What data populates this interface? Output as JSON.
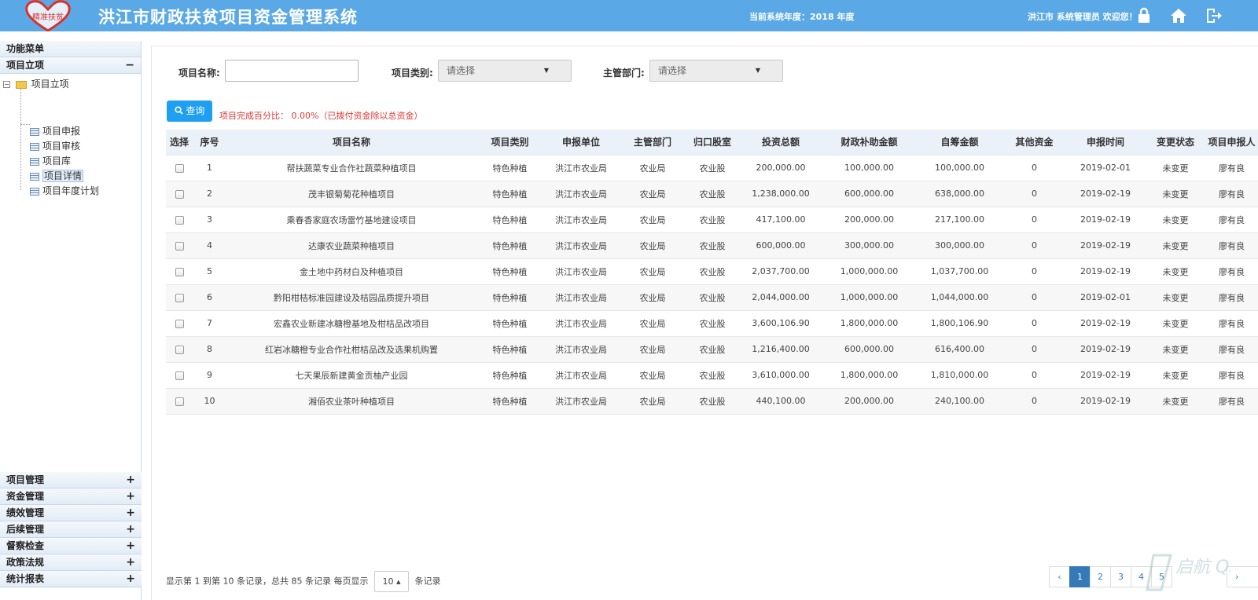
{
  "header": {
    "logo_text": "精准扶贫",
    "title": "洪江市财政扶贫项目资金管理系统",
    "year_text": "当前系统年度：2018 年度",
    "user_text": "洪江市 系统管理员 欢迎您！",
    "bg_color": "#5aa9e6",
    "icons": [
      "lock-icon",
      "home-icon",
      "logout-icon"
    ]
  },
  "sidebar": {
    "menu_title": "功能菜单",
    "active_group": "项目立项",
    "active_group_sign": "−",
    "tree_root": "项目立项",
    "tree_items": [
      "项目申报",
      "项目审核",
      "项目库",
      "项目详情",
      "项目年度计划"
    ],
    "selected_item": "项目详情",
    "groups": [
      {
        "label": "项目管理",
        "sign": "+"
      },
      {
        "label": "资金管理",
        "sign": "+"
      },
      {
        "label": "绩效管理",
        "sign": "+"
      },
      {
        "label": "后续管理",
        "sign": "+"
      },
      {
        "label": "督察检查",
        "sign": "+"
      },
      {
        "label": "政策法规",
        "sign": "+"
      },
      {
        "label": "统计报表",
        "sign": "+"
      }
    ]
  },
  "filters": {
    "name_label": "项目名称:",
    "name_value": "",
    "type_label": "项目类别:",
    "type_value": "请选择",
    "dept_label": "主管部门:",
    "dept_value": "请选择",
    "query_label": "查询",
    "completion_text": "项目完成百分比： 0.00%（已拨付资金除以总资金）"
  },
  "table": {
    "columns": [
      "选择",
      "序号",
      "项目名称",
      "项目类别",
      "申报单位",
      "主管部门",
      "归口股室",
      "投资总额",
      "财政补助金额",
      "自筹金额",
      "其他资金",
      "申报时间",
      "变更状态",
      "项目申报人"
    ],
    "rows": [
      [
        "",
        "1",
        "帮扶蔬菜专业合作社蔬菜种植项目",
        "特色种植",
        "洪江市农业局",
        "农业局",
        "农业股",
        "200,000.00",
        "100,000.00",
        "100,000.00",
        "0",
        "2019-02-01",
        "未变更",
        "廖有良"
      ],
      [
        "",
        "2",
        "茂丰银菊菊花种植项目",
        "特色种植",
        "洪江市农业局",
        "农业局",
        "农业股",
        "1,238,000.00",
        "600,000.00",
        "638,000.00",
        "0",
        "2019-02-19",
        "未变更",
        "廖有良"
      ],
      [
        "",
        "3",
        "乘春香家庭农场雷竹基地建设项目",
        "特色种植",
        "洪江市农业局",
        "农业局",
        "农业股",
        "417,100.00",
        "200,000.00",
        "217,100.00",
        "0",
        "2019-02-19",
        "未变更",
        "廖有良"
      ],
      [
        "",
        "4",
        "达康农业蔬菜种植项目",
        "特色种植",
        "洪江市农业局",
        "农业局",
        "农业股",
        "600,000.00",
        "300,000.00",
        "300,000.00",
        "0",
        "2019-02-19",
        "未变更",
        "廖有良"
      ],
      [
        "",
        "5",
        "金土地中药材白及种植项目",
        "特色种植",
        "洪江市农业局",
        "农业局",
        "农业股",
        "2,037,700.00",
        "1,000,000.00",
        "1,037,700.00",
        "0",
        "2019-02-19",
        "未变更",
        "廖有良"
      ],
      [
        "",
        "6",
        "黔阳柑桔标准园建设及桔园品质提升项目",
        "特色种植",
        "洪江市农业局",
        "农业局",
        "农业股",
        "2,044,000.00",
        "1,000,000.00",
        "1,044,000.00",
        "0",
        "2019-02-01",
        "未变更",
        "廖有良"
      ],
      [
        "",
        "7",
        "宏鑫农业新建冰糖橙基地及柑桔品改项目",
        "特色种植",
        "洪江市农业局",
        "农业局",
        "农业股",
        "3,600,106.90",
        "1,800,000.00",
        "1,800,106.90",
        "0",
        "2019-02-19",
        "未变更",
        "廖有良"
      ],
      [
        "",
        "8",
        "红岩冰糖橙专业合作社柑桔品改及选果机购置",
        "特色种植",
        "洪江市农业局",
        "农业局",
        "农业股",
        "1,216,400.00",
        "600,000.00",
        "616,400.00",
        "0",
        "2019-02-19",
        "未变更",
        "廖有良"
      ],
      [
        "",
        "9",
        "七天果辰新建黄金贡柚产业园",
        "特色种植",
        "洪江市农业局",
        "农业局",
        "农业股",
        "3,610,000.00",
        "1,800,000.00",
        "1,810,000.00",
        "0",
        "2019-02-19",
        "未变更",
        "廖有良"
      ],
      [
        "",
        "10",
        "湘佰农业茶叶种植项目",
        "特色种植",
        "洪江市农业局",
        "农业局",
        "农业股",
        "440,100.00",
        "200,000.00",
        "240,100.00",
        "0",
        "2019-02-19",
        "未变更",
        "廖有良"
      ]
    ]
  },
  "pagination": {
    "info_prefix": "显示第 1 到第 10 条记录，总共 85 条记录 每页显示",
    "page_size": "10 ▴",
    "info_suffix": "条记录",
    "prev": "‹",
    "pages": [
      "1",
      "2",
      "3",
      "4",
      "5"
    ],
    "current": "1",
    "next": "›"
  },
  "watermark": "启航 QHCMS.NET"
}
